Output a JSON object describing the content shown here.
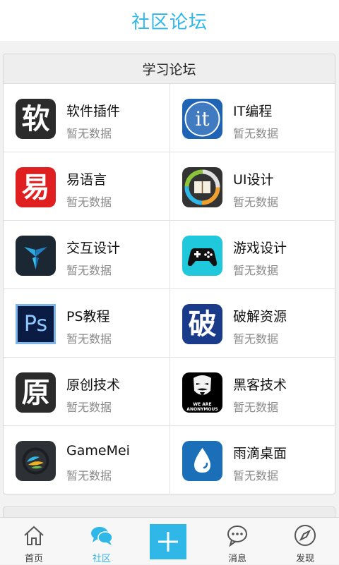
{
  "header": {
    "title": "社区论坛"
  },
  "section": {
    "title": "学习论坛",
    "items": [
      {
        "name": "软件插件",
        "status": "暂无数据",
        "icon": "ruanjian-icon",
        "icon_text": "软",
        "icon_bg": "#2b2b2b"
      },
      {
        "name": "IT编程",
        "status": "暂无数据",
        "icon": "it-icon",
        "icon_text": "it",
        "icon_bg": "#1f63b5"
      },
      {
        "name": "易语言",
        "status": "暂无数据",
        "icon": "yi-icon",
        "icon_text": "易",
        "icon_bg": "#e02020"
      },
      {
        "name": "UI设计",
        "status": "暂无数据",
        "icon": "book-ring-icon",
        "icon_bg": "#333333"
      },
      {
        "name": "交互设计",
        "status": "暂无数据",
        "icon": "triad-logo-icon",
        "icon_bg": "#1b2733"
      },
      {
        "name": "游戏设计",
        "status": "暂无数据",
        "icon": "gamepad-icon",
        "icon_bg": "#20c8dc"
      },
      {
        "name": "PS教程",
        "status": "暂无数据",
        "icon": "photoshop-icon",
        "icon_text": "Ps",
        "icon_bg": "#0a1b44"
      },
      {
        "name": "破解资源",
        "status": "暂无数据",
        "icon": "po-icon",
        "icon_text": "破",
        "icon_bg": "#1a3a8a"
      },
      {
        "name": "原创技术",
        "status": "暂无数据",
        "icon": "yuan-icon",
        "icon_text": "原",
        "icon_bg": "#2b2b2b"
      },
      {
        "name": "黑客技术",
        "status": "暂无数据",
        "icon": "anonymous-mask-icon",
        "icon_text": "WE ARE ANONYMOUS",
        "icon_bg": "#000000"
      },
      {
        "name": "GameMei",
        "status": "暂无数据",
        "icon": "gamemei-logo-icon",
        "icon_bg": "#2d3136"
      },
      {
        "name": "雨滴桌面",
        "status": "暂无数据",
        "icon": "raindrop-icon",
        "icon_bg": "#1a6fb8"
      }
    ]
  },
  "tabbar": {
    "tabs": [
      {
        "label": "首页",
        "icon": "home-icon"
      },
      {
        "label": "社区",
        "icon": "chat-bubbles-icon",
        "active": true
      },
      {
        "label": "",
        "icon": "plus-icon"
      },
      {
        "label": "消息",
        "icon": "message-icon"
      },
      {
        "label": "发现",
        "icon": "compass-icon"
      }
    ]
  },
  "colors": {
    "accent": "#2fb7e8"
  }
}
